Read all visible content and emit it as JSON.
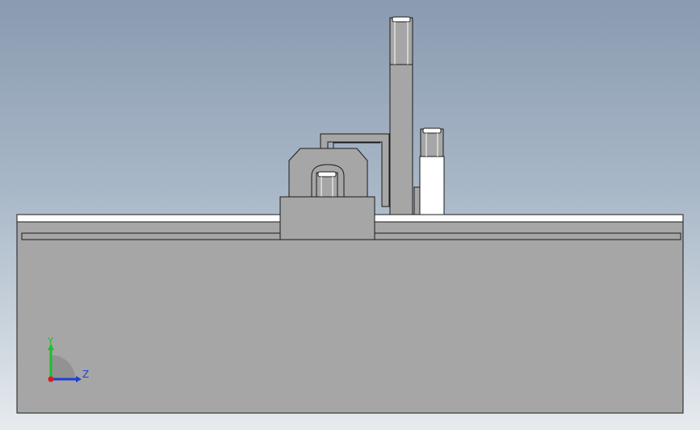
{
  "viewport": {
    "view": "Front view",
    "colors": {
      "background_top": "#8a9bb0",
      "background_bottom": "#e6ebef",
      "part_fill": "#a6a6a6",
      "part_fill_dark": "#8e8e8e",
      "edge": "#1a1a1a",
      "highlight": "#ffffff"
    }
  },
  "triad": {
    "y_label": "Y",
    "z_label": "Z",
    "y_color": "#1fbf2a",
    "z_color": "#1f3fd1",
    "x_color": "#d11f1f"
  }
}
